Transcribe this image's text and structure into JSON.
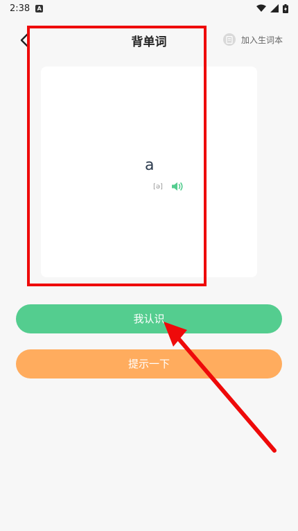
{
  "status_bar": {
    "time": "2:38",
    "notif_letter": "A"
  },
  "header": {
    "title": "背单词",
    "add_vocab_label": "加入生词本"
  },
  "card": {
    "word": "a",
    "phonetic": "[ə]"
  },
  "buttons": {
    "know_label": "我认识",
    "hint_label": "提示一下"
  },
  "colors": {
    "know_button": "#54cd8f",
    "hint_button": "#ffac5e",
    "speaker": "#54cd8f",
    "annotation": "#ee0a0a"
  },
  "icons": {
    "back": "chevron-left-icon",
    "vocab": "notebook-icon",
    "speaker": "speaker-icon",
    "wifi": "wifi-icon",
    "signal": "signal-icon",
    "battery": "battery-icon"
  }
}
